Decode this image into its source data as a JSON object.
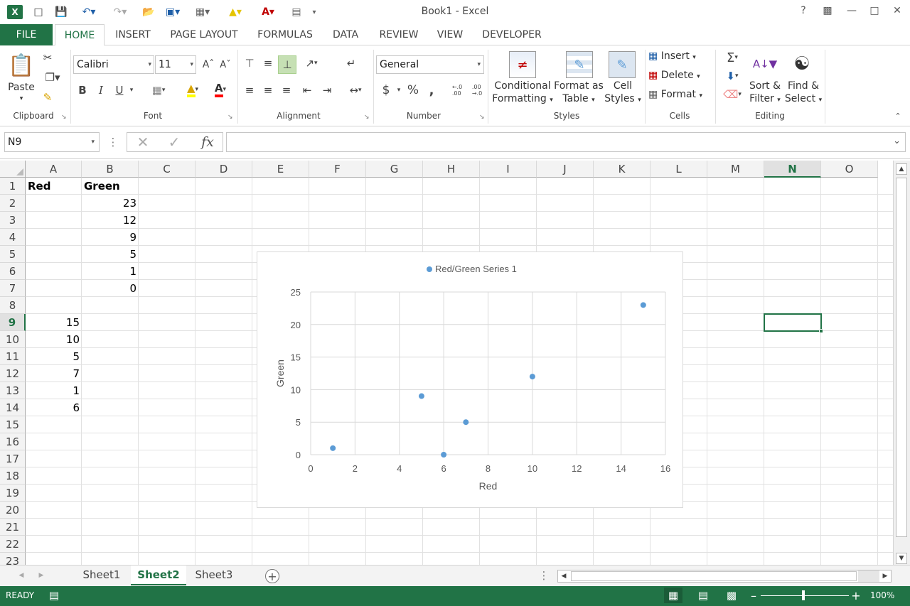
{
  "window": {
    "title": "Book1 - Excel",
    "help": "?"
  },
  "tabs": [
    "FILE",
    "HOME",
    "INSERT",
    "PAGE LAYOUT",
    "FORMULAS",
    "DATA",
    "REVIEW",
    "VIEW",
    "DEVELOPER"
  ],
  "ribbon": {
    "clipboard": {
      "paste": "Paste",
      "label": "Clipboard"
    },
    "font": {
      "name": "Calibri",
      "size": "11",
      "label": "Font",
      "bold": "B",
      "italic": "I",
      "underline": "U"
    },
    "alignment": {
      "label": "Alignment"
    },
    "number": {
      "format": "General",
      "label": "Number",
      "currency": "$",
      "percent": "%",
      "comma": ","
    },
    "styles": {
      "cond1": "Conditional",
      "cond2": "Formatting",
      "fmt1": "Format as",
      "fmt2": "Table",
      "cell1": "Cell",
      "cell2": "Styles",
      "label": "Styles"
    },
    "cells": {
      "insert": "Insert",
      "delete": "Delete",
      "format": "Format",
      "label": "Cells"
    },
    "editing": {
      "sort1": "Sort &",
      "sort2": "Filter",
      "find1": "Find &",
      "find2": "Select",
      "label": "Editing"
    }
  },
  "formula_bar": {
    "name_box": "N9",
    "fx": "fx",
    "value": ""
  },
  "columns": [
    "A",
    "B",
    "C",
    "D",
    "E",
    "F",
    "G",
    "H",
    "I",
    "J",
    "K",
    "L",
    "M",
    "N",
    "O"
  ],
  "selected_cell": {
    "column": "N",
    "row": 9
  },
  "rows": [
    "1",
    "2",
    "3",
    "4",
    "5",
    "6",
    "7",
    "8",
    "9",
    "10",
    "11",
    "12",
    "13",
    "14",
    "15",
    "16",
    "17",
    "18",
    "19",
    "20",
    "21",
    "22",
    "23"
  ],
  "cells": {
    "A1": "Red",
    "B1": "Green",
    "B2": "23",
    "B3": "12",
    "B4": "9",
    "B5": "5",
    "B6": "1",
    "B7": "0",
    "A9": "15",
    "A10": "10",
    "A11": "5",
    "A12": "7",
    "A13": "1",
    "A14": "6"
  },
  "chart_data": {
    "type": "scatter",
    "legend": "Red/Green Series 1",
    "legend_position": "top",
    "xlabel": "Red",
    "ylabel": "Green",
    "xlim": [
      0,
      16
    ],
    "ylim": [
      0,
      25
    ],
    "xticks": [
      "0",
      "2",
      "4",
      "6",
      "8",
      "10",
      "12",
      "14",
      "16"
    ],
    "yticks": [
      "0",
      "5",
      "10",
      "15",
      "20",
      "25"
    ],
    "grid": true,
    "color": "#5b9bd5",
    "points": [
      {
        "x": 15,
        "y": 23
      },
      {
        "x": 10,
        "y": 12
      },
      {
        "x": 5,
        "y": 9
      },
      {
        "x": 7,
        "y": 5
      },
      {
        "x": 1,
        "y": 1
      },
      {
        "x": 6,
        "y": 0
      }
    ]
  },
  "sheets": [
    "Sheet1",
    "Sheet2",
    "Sheet3"
  ],
  "active_sheet": "Sheet2",
  "status": {
    "mode": "READY",
    "zoom": "100%"
  },
  "colors": {
    "accent": "#217346",
    "series": "#5b9bd5"
  }
}
